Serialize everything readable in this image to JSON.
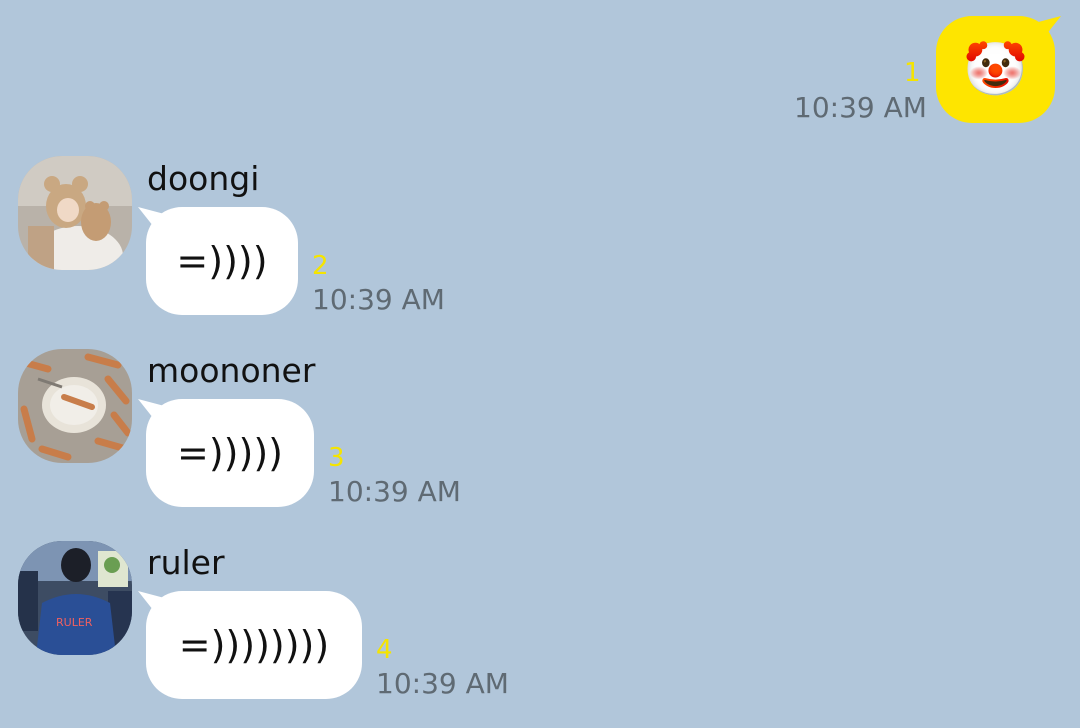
{
  "colors": {
    "background": "#b1c6da",
    "incoming_bubble": "#ffffff",
    "outgoing_bubble": "#fee500",
    "unread_count": "#f5e400",
    "timestamp": "#5f6a73"
  },
  "messages": [
    {
      "direction": "outgoing",
      "content": "🤡",
      "content_icon": "clown-face-emoji",
      "unread_count": "1",
      "time": "10:39 AM"
    },
    {
      "direction": "incoming",
      "sender": "doongi",
      "avatar_icon": "avatar-doongi",
      "content": "=))))",
      "unread_count": "2",
      "time": "10:39 AM"
    },
    {
      "direction": "incoming",
      "sender": "moononer",
      "avatar_icon": "avatar-moononer",
      "content": "=)))))",
      "unread_count": "3",
      "time": "10:39 AM"
    },
    {
      "direction": "incoming",
      "sender": "ruler",
      "avatar_icon": "avatar-ruler",
      "content": "=))))))))",
      "unread_count": "4",
      "time": "10:39 AM",
      "avatar_text": "RULER"
    }
  ]
}
